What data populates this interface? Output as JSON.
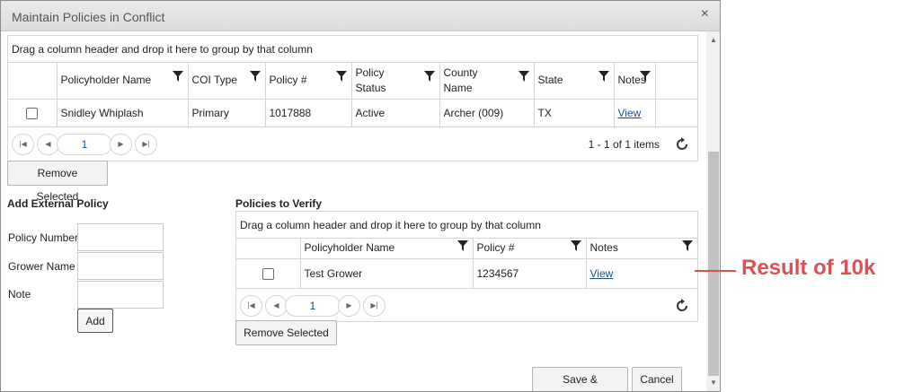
{
  "dialog": {
    "title": "Maintain Policies in Conflict",
    "close_glyph": "×"
  },
  "conflict_grid": {
    "group_hint": "Drag a column header and drop it here to group by that column",
    "columns": [
      "Policyholder Name",
      "COI Type",
      "Policy #",
      "Policy Status",
      "County Name",
      "State",
      "Notes"
    ],
    "rows": [
      {
        "policyholder_name": "Snidley Whiplash",
        "coi_type": "Primary",
        "policy_number": "1017888",
        "policy_status": "Active",
        "county_name": "Archer (009)",
        "state": "TX",
        "notes_link": "View"
      }
    ],
    "pager": {
      "page": "1",
      "info": "1 - 1 of 1 items"
    },
    "remove_label": "Remove Selected"
  },
  "external_policy": {
    "title": "Add External Policy",
    "fields": {
      "policy_number_label": "Policy Number",
      "grower_name_label": "Grower Name",
      "note_label": "Note",
      "policy_number_value": "",
      "grower_name_value": "",
      "note_value": ""
    },
    "add_label": "Add"
  },
  "verify_grid": {
    "title": "Policies to Verify",
    "group_hint": "Drag a column header and drop it here to group by that column",
    "columns": [
      "Policyholder Name",
      "Policy #",
      "Notes"
    ],
    "rows": [
      {
        "policyholder_name": "Test Grower",
        "policy_number": "1234567",
        "notes_link": "View"
      }
    ],
    "pager": {
      "page": "1"
    },
    "remove_label": "Remove Selected"
  },
  "footer": {
    "save_label": "Save & Continue",
    "cancel_label": "Cancel"
  },
  "annotation": {
    "text": "Result of 10k",
    "color": "#e05050"
  },
  "icons": [
    "close-icon",
    "filter-icon",
    "first-page-icon",
    "prev-page-icon",
    "next-page-icon",
    "last-page-icon",
    "refresh-icon"
  ],
  "colors": {
    "link": "#1a4f8b",
    "border": "#d5d5d5",
    "titlebar": "#e2e2e2"
  }
}
